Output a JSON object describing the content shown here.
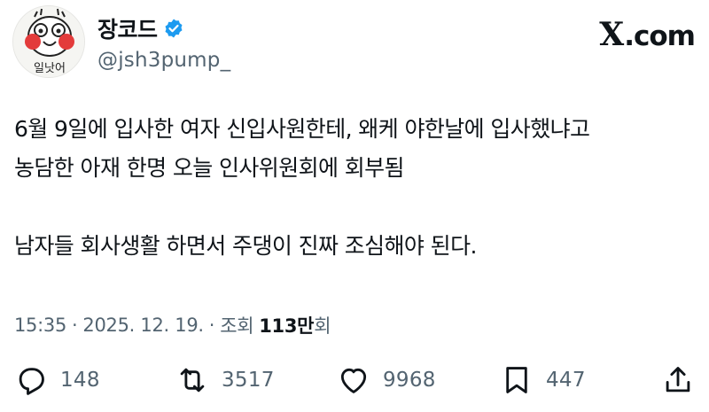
{
  "author": {
    "name": "장코드",
    "handle": "@jsh3pump_",
    "avatar_caption": "일낫어"
  },
  "brand": {
    "x": "X",
    "dotcom": ".com"
  },
  "tweet": {
    "lines": [
      "6월 9일에 입사한 여자 신입사원한테, 왜케 야한날에 입사했냐고",
      "농담한 아재 한명 오늘 인사위원회에 회부됨",
      "남자들 회사생활 하면서 주댕이 진짜 조심해야 된다."
    ]
  },
  "meta": {
    "time": "15:35",
    "separator": "·",
    "date": "2025. 12. 19.",
    "separator2": "·",
    "views_prefix": "조회",
    "views_count": "113만",
    "views_suffix": "회"
  },
  "actions": {
    "reply": "148",
    "retweet": "3517",
    "like": "9968",
    "bookmark": "447"
  },
  "colors": {
    "verified": "#1d9bf0",
    "text": "#0f1419",
    "muted": "#536471"
  }
}
